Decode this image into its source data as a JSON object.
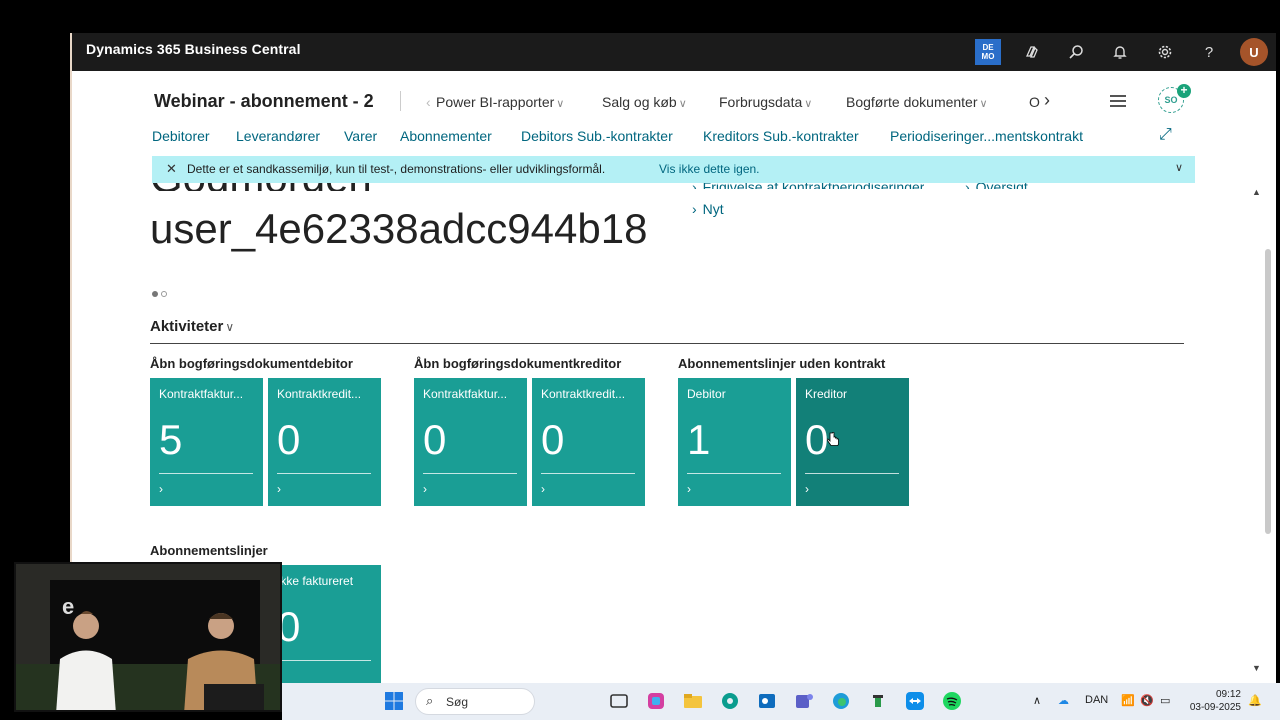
{
  "topbar": {
    "app_title": "Dynamics 365 Business Central",
    "demo_badge": "DE MO",
    "avatar_initial": "U"
  },
  "header": {
    "company_name": "Webinar - abonnement - 2",
    "nav_items": [
      "Power BI-rapporter",
      "Salg og køb",
      "Forbrugsdata",
      "Bogførte dokumenter",
      "O"
    ],
    "user_badge": "SO",
    "sub_nav": [
      "Debitorer",
      "Leverandører",
      "Varer",
      "Abonnementer",
      "Debitors Sub.-kontrakter",
      "Kreditors Sub.-kontrakter",
      "Periodiseringer...mentskontrakt"
    ]
  },
  "banner": {
    "message": "Dette er et sandkassemiljø, kun til test-, demonstrations- eller udviklingsformål.",
    "dismiss_link": "Vis ikke dette igen."
  },
  "headline": {
    "greeting": "Godmorgen",
    "user": "user_4e62338adcc944b18",
    "action_links": [
      "Frigivelse af kontraktperiodiseringer",
      "Oversigt",
      "Nyt"
    ]
  },
  "activities": {
    "title": "Aktiviteter",
    "groups": [
      {
        "title": "Åbn bogføringsdokumentdebitor",
        "tiles": [
          {
            "label": "Kontraktfaktur...",
            "value": "5"
          },
          {
            "label": "Kontraktkredit...",
            "value": "0"
          }
        ]
      },
      {
        "title": "Åbn bogføringsdokumentkreditor",
        "tiles": [
          {
            "label": "Kontraktfaktur...",
            "value": "0"
          },
          {
            "label": "Kontraktkredit...",
            "value": "0"
          }
        ]
      },
      {
        "title": "Abonnementslinjer uden kontrakt",
        "tiles": [
          {
            "label": "Debitor",
            "value": "1"
          },
          {
            "label": "Kreditor",
            "value": "0"
          }
        ]
      },
      {
        "title": "Abonnementslinjer",
        "tiles": [
          {
            "label": "Ikke faktureret",
            "value": "0"
          }
        ]
      }
    ]
  },
  "webcam": {
    "logo_text": "e"
  },
  "taskbar": {
    "search_label": "Søg",
    "language": "DAN",
    "time": "09:12",
    "date": "03-09-2025"
  },
  "colors": {
    "tile": "#1a9e95",
    "tile_active": "#128078",
    "banner": "#b4f0f5",
    "link": "#00667f",
    "topbar": "#1b1b1b"
  }
}
